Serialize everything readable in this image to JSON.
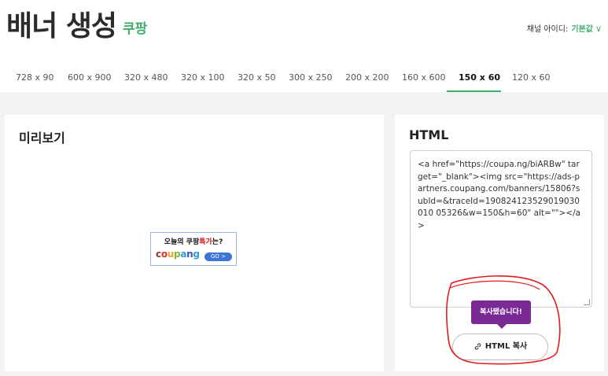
{
  "header": {
    "title": "배너 생성",
    "subtitle": "쿠팡",
    "channel_label": "채널 아이디:",
    "channel_value": "기본값"
  },
  "tabs": [
    {
      "label": "728 x 90"
    },
    {
      "label": "600 x 900"
    },
    {
      "label": "320 x 480"
    },
    {
      "label": "320 x 100"
    },
    {
      "label": "320 x 50"
    },
    {
      "label": "300 x 250"
    },
    {
      "label": "200 x 200"
    },
    {
      "label": "160 x 600"
    },
    {
      "label": "150 x 60",
      "active": true
    },
    {
      "label": "120 x 60"
    }
  ],
  "preview": {
    "title": "미리보기",
    "banner": {
      "text_before": "오늘의 쿠팡",
      "text_highlight": "특가",
      "text_after": "는?",
      "brand": "coupang",
      "go_label": "GO >"
    }
  },
  "html_panel": {
    "title": "HTML",
    "code": "<a href=\"https://coupa.ng/biARBw\" target=\"_blank\"><img src=\"https://ads-partners.coupang.com/banners/15806?subId=&traceId=190824123529019030010 05326&w=150&h=60\" alt=\"\"></a>",
    "tooltip": "복사됐습니다!",
    "copy_button": "HTML 복사"
  },
  "colors": {
    "accent": "#3fae6a",
    "tooltip": "#7a2a95",
    "go_button": "#3d74d6",
    "annotation": "#e21b1b"
  }
}
